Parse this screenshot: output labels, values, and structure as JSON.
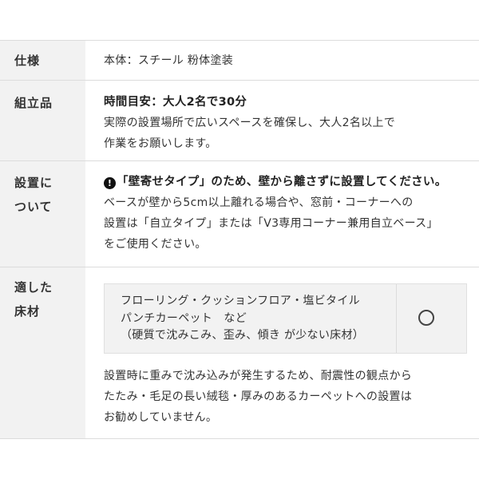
{
  "rows": {
    "spec": {
      "label": "仕様",
      "value": "本体：スチール 粉体塗装"
    },
    "assembly": {
      "label": "組立品",
      "lines": [
        "時間目安：大人2名で30分",
        "実際の設置場所で広いスペースを確保し、大人2名以上で",
        "作業をお願いします。"
      ]
    },
    "install": {
      "label_lines": [
        "設置に",
        "ついて"
      ],
      "warning_icon": "exclamation-circle-icon",
      "warning": "「壁寄せタイプ」のため、壁から離さずに設置してください。",
      "lines": [
        "ベースが壁から5cm以上離れる場合や、窓前・コーナーへの",
        "設置は「自立タイプ」または「V3専用コーナー兼用自立ベース」",
        "をご使用ください。"
      ]
    },
    "floor": {
      "label_lines": [
        "適した",
        "床材"
      ],
      "box_lines": [
        "フローリング・クッションフロア・塩ビタイル",
        "パンチカーペット　など",
        "（硬質で沈みこみ、歪み、傾き が少ない床材）"
      ],
      "suitability_mark": "circle-icon",
      "note_lines": [
        "設置時に重みで沈み込みが発生するため、耐震性の観点から",
        "たたみ・毛足の長い絨毯・厚みのあるカーペットへの設置は",
        "お勧めしていません。"
      ]
    }
  }
}
